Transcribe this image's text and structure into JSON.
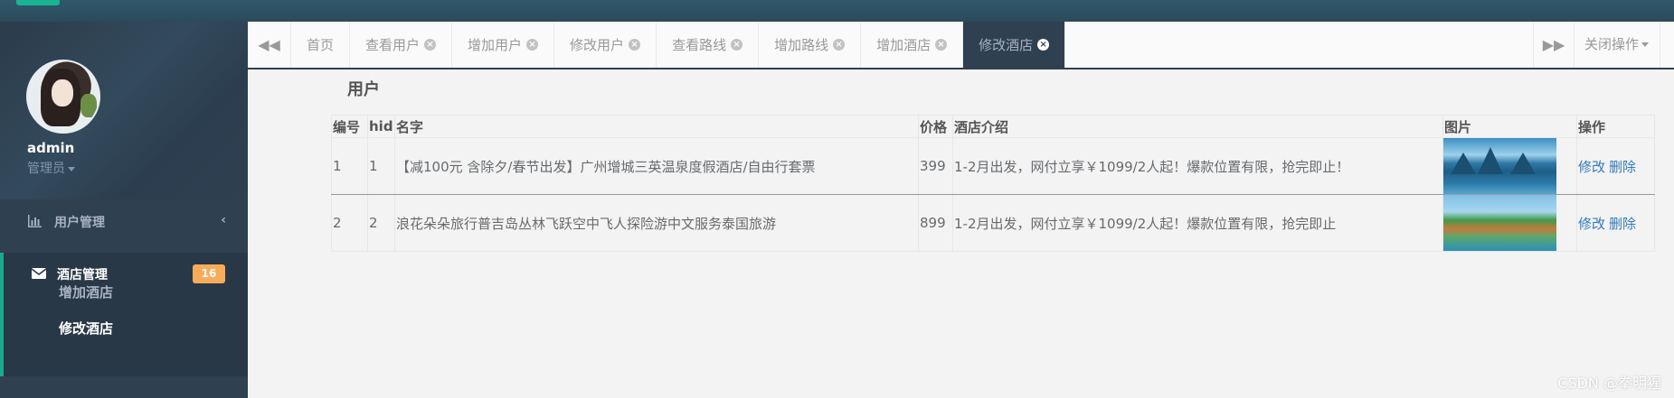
{
  "sidebar": {
    "profile": {
      "name": "admin",
      "role": "管理员"
    },
    "menu": [
      {
        "label": "用户管理",
        "icon": "bar-chart-icon"
      },
      {
        "label": "酒店管理",
        "icon": "envelope-icon",
        "badge": "16",
        "children": [
          {
            "label": "增加酒店"
          },
          {
            "label": "修改酒店"
          }
        ]
      }
    ]
  },
  "tabs": [
    {
      "label": "首页",
      "closable": false
    },
    {
      "label": "查看用户",
      "closable": true
    },
    {
      "label": "增加用户",
      "closable": true
    },
    {
      "label": "修改用户",
      "closable": true
    },
    {
      "label": "查看路线",
      "closable": true
    },
    {
      "label": "增加路线",
      "closable": true
    },
    {
      "label": "增加酒店",
      "closable": true
    },
    {
      "label": "修改酒店",
      "closable": true,
      "active": true
    }
  ],
  "close_ops_label": "关闭操作",
  "content": {
    "title": "用户",
    "table": {
      "headers": [
        "编号",
        "hid",
        "名字",
        "价格",
        "酒店介绍",
        "图片",
        "操作"
      ],
      "rows": [
        {
          "id": "1",
          "hid": "1",
          "name": "【减100元 含除夕/春节出发】广州增城三英温泉度假酒店/自由行套票",
          "price": "399",
          "intro": "1-2月出发，网付立享￥1099/2人起！爆款位置有限，抢完即止！",
          "image": "lake-mountains-photo"
        },
        {
          "id": "2",
          "hid": "2",
          "name": "浪花朵朵旅行普吉岛丛林飞跃空中飞人探险游中文服务泰国旅游",
          "price": "899",
          "intro": "1-2月出发，网付立享￥1099/2人起！爆款位置有限，抢完即止",
          "image": "island-coast-photo"
        }
      ],
      "actions": {
        "edit": "修改",
        "delete": "删除"
      }
    }
  },
  "watermark": "CSDN @拳明猩",
  "colors": {
    "sidebar": "#2f4050",
    "accent": "#1ab394",
    "badge": "#f8ac59",
    "link": "#337ab7"
  }
}
